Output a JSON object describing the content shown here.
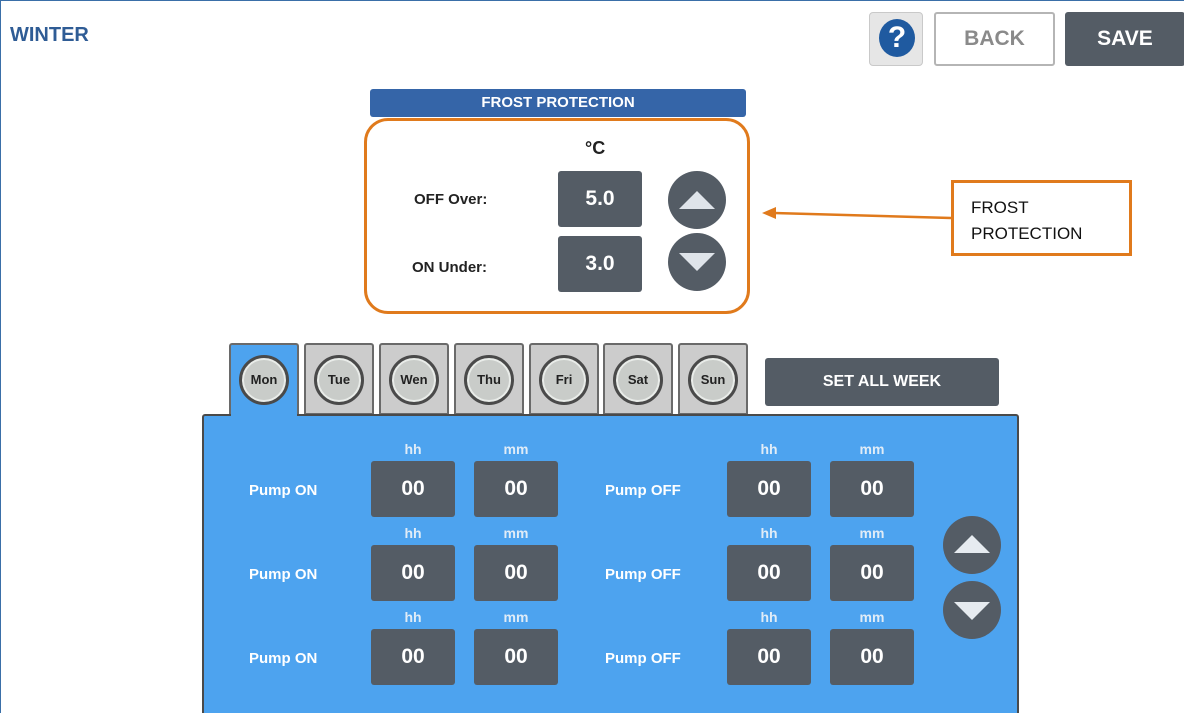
{
  "header": {
    "title": "WINTER",
    "help_label": "?",
    "back_label": "BACK",
    "save_label": "SAVE"
  },
  "frost_protection": {
    "header": "FROST PROTECTION",
    "unit": "°C",
    "off_over_label": "OFF Over:",
    "off_over_value": "5.0",
    "on_under_label": "ON Under:",
    "on_under_value": "3.0"
  },
  "callout": {
    "text": "FROST PROTECTION"
  },
  "days": [
    "Mon",
    "Tue",
    "Wen",
    "Thu",
    "Fri",
    "Sat",
    "Sun"
  ],
  "active_day": "Mon",
  "set_all_week_label": "SET ALL WEEK",
  "schedule": {
    "hh_label": "hh",
    "mm_label": "mm",
    "pump_on_label": "Pump ON",
    "pump_off_label": "Pump OFF",
    "rows": [
      {
        "on_hh": "00",
        "on_mm": "00",
        "off_hh": "00",
        "off_mm": "00"
      },
      {
        "on_hh": "00",
        "on_mm": "00",
        "off_hh": "00",
        "off_mm": "00"
      },
      {
        "on_hh": "00",
        "on_mm": "00",
        "off_hh": "00",
        "off_mm": "00"
      }
    ]
  },
  "colors": {
    "accent_blue": "#3565a8",
    "panel_blue": "#4da3ef",
    "dark_button": "#545c65",
    "callout_orange": "#e07a1c"
  }
}
